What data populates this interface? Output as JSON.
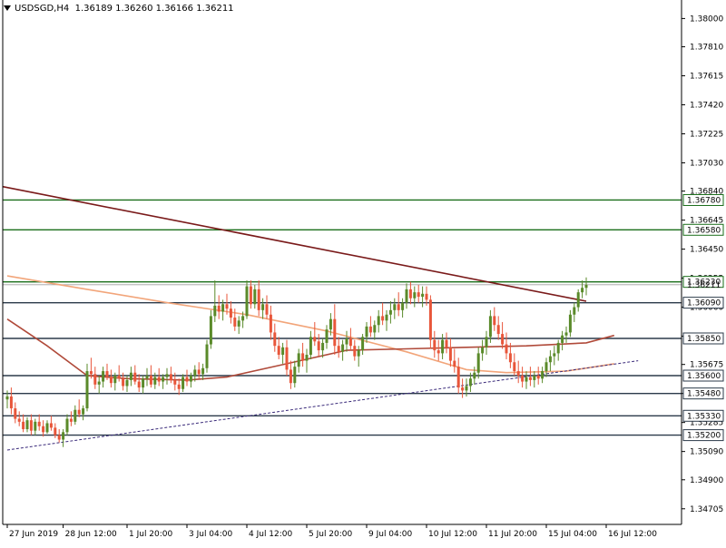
{
  "header": {
    "symbol": "USDSGD,H4",
    "ohlc": "1.36189 1.36260 1.36166 1.36211"
  },
  "colors": {
    "bull": "#5a8a2a",
    "bear": "#e8563a",
    "level": "#1a6e1a",
    "support": "#2b3a4a",
    "ma_slow": "#7a1a1a",
    "ma_mid": "#b04a3a",
    "ma_fast": "#f2a57a",
    "trend": "#3a2a7a"
  },
  "chart_data": {
    "type": "candlestick",
    "symbol": "USDSGD",
    "timeframe": "H4",
    "ylim": [
      1.346,
      1.381
    ],
    "y_ticks": [
      "1.38000",
      "1.37810",
      "1.37615",
      "1.37420",
      "1.37225",
      "1.37030",
      "1.36840",
      "1.36645",
      "1.36450",
      "1.36255",
      "1.36060",
      "1.35865",
      "1.35675",
      "1.35480",
      "1.35285",
      "1.35090",
      "1.34900",
      "1.34705"
    ],
    "x_labels": [
      {
        "i": 0,
        "label": "27 Jun 2019"
      },
      {
        "i": 14,
        "label": "28 Jun 12:00"
      },
      {
        "i": 30,
        "label": "1 Jul 20:00"
      },
      {
        "i": 45,
        "label": "3 Jul 04:00"
      },
      {
        "i": 60,
        "label": "4 Jul 12:00"
      },
      {
        "i": 75,
        "label": "5 Jul 20:00"
      },
      {
        "i": 90,
        "label": "9 Jul 04:00"
      },
      {
        "i": 105,
        "label": "10 Jul 12:00"
      },
      {
        "i": 120,
        "label": "11 Jul 20:00"
      },
      {
        "i": 135,
        "label": "15 Jul 04:00"
      },
      {
        "i": 150,
        "label": "16 Jul 12:00"
      }
    ],
    "candles": [
      [
        1.3544,
        1.355,
        1.3538,
        1.3546
      ],
      [
        1.3546,
        1.3552,
        1.3534,
        1.3538
      ],
      [
        1.3538,
        1.3542,
        1.3528,
        1.3531
      ],
      [
        1.3531,
        1.3536,
        1.3526,
        1.3529
      ],
      [
        1.3529,
        1.3534,
        1.3522,
        1.3524
      ],
      [
        1.3524,
        1.3532,
        1.3522,
        1.353
      ],
      [
        1.353,
        1.3534,
        1.352,
        1.3523
      ],
      [
        1.3523,
        1.3531,
        1.352,
        1.3529
      ],
      [
        1.3529,
        1.3534,
        1.3523,
        1.3526
      ],
      [
        1.3526,
        1.353,
        1.3519,
        1.3522
      ],
      [
        1.3522,
        1.353,
        1.3521,
        1.3528
      ],
      [
        1.3528,
        1.3533,
        1.3523,
        1.3525
      ],
      [
        1.3525,
        1.3528,
        1.3518,
        1.352
      ],
      [
        1.352,
        1.3524,
        1.3515,
        1.3517
      ],
      [
        1.3517,
        1.3524,
        1.3512,
        1.3522
      ],
      [
        1.3522,
        1.3534,
        1.352,
        1.3531
      ],
      [
        1.3531,
        1.3536,
        1.3526,
        1.3529
      ],
      [
        1.3529,
        1.354,
        1.3527,
        1.3537
      ],
      [
        1.3537,
        1.3544,
        1.3532,
        1.3534
      ],
      [
        1.3534,
        1.354,
        1.353,
        1.3538
      ],
      [
        1.3538,
        1.3568,
        1.3536,
        1.3563
      ],
      [
        1.3563,
        1.3572,
        1.3558,
        1.3561
      ],
      [
        1.3561,
        1.3566,
        1.3551,
        1.3554
      ],
      [
        1.3554,
        1.356,
        1.3548,
        1.3556
      ],
      [
        1.3556,
        1.3566,
        1.3552,
        1.3563
      ],
      [
        1.3563,
        1.3568,
        1.3557,
        1.3559
      ],
      [
        1.3559,
        1.3564,
        1.3552,
        1.3555
      ],
      [
        1.3555,
        1.3562,
        1.355,
        1.356
      ],
      [
        1.356,
        1.3567,
        1.3556,
        1.3558
      ],
      [
        1.3558,
        1.3562,
        1.355,
        1.3553
      ],
      [
        1.3553,
        1.356,
        1.3549,
        1.3557
      ],
      [
        1.3557,
        1.3566,
        1.3553,
        1.3562
      ],
      [
        1.3562,
        1.3567,
        1.3554,
        1.3556
      ],
      [
        1.3556,
        1.3561,
        1.3549,
        1.3552
      ],
      [
        1.3552,
        1.356,
        1.3548,
        1.3558
      ],
      [
        1.3558,
        1.3565,
        1.3553,
        1.356
      ],
      [
        1.356,
        1.3567,
        1.3552,
        1.3554
      ],
      [
        1.3554,
        1.3562,
        1.3551,
        1.3559
      ],
      [
        1.3559,
        1.3565,
        1.3553,
        1.3556
      ],
      [
        1.3556,
        1.3561,
        1.3551,
        1.3559
      ],
      [
        1.3559,
        1.3565,
        1.3554,
        1.3561
      ],
      [
        1.3561,
        1.3566,
        1.3555,
        1.3557
      ],
      [
        1.3557,
        1.3562,
        1.355,
        1.3554
      ],
      [
        1.3554,
        1.3558,
        1.3547,
        1.3551
      ],
      [
        1.3551,
        1.3561,
        1.3549,
        1.3559
      ],
      [
        1.3559,
        1.3564,
        1.3553,
        1.3556
      ],
      [
        1.3556,
        1.3562,
        1.3552,
        1.356
      ],
      [
        1.356,
        1.3567,
        1.3556,
        1.3564
      ],
      [
        1.3564,
        1.3569,
        1.3558,
        1.3561
      ],
      [
        1.3561,
        1.3568,
        1.3557,
        1.3565
      ],
      [
        1.3565,
        1.3584,
        1.3562,
        1.3581
      ],
      [
        1.3581,
        1.3604,
        1.3578,
        1.36
      ],
      [
        1.36,
        1.3624,
        1.3596,
        1.3607
      ],
      [
        1.3607,
        1.3614,
        1.3598,
        1.3603
      ],
      [
        1.3603,
        1.3611,
        1.3597,
        1.3608
      ],
      [
        1.3608,
        1.3615,
        1.3601,
        1.3605
      ],
      [
        1.3605,
        1.361,
        1.3595,
        1.3599
      ],
      [
        1.3599,
        1.3605,
        1.359,
        1.3593
      ],
      [
        1.3593,
        1.36,
        1.3588,
        1.3597
      ],
      [
        1.3597,
        1.3603,
        1.3592,
        1.36
      ],
      [
        1.36,
        1.3624,
        1.3598,
        1.362
      ],
      [
        1.362,
        1.3624,
        1.3605,
        1.3608
      ],
      [
        1.3608,
        1.3621,
        1.3605,
        1.3618
      ],
      [
        1.3618,
        1.3624,
        1.36,
        1.3604
      ],
      [
        1.3604,
        1.3612,
        1.3598,
        1.3608
      ],
      [
        1.3608,
        1.3614,
        1.3598,
        1.3601
      ],
      [
        1.3601,
        1.3607,
        1.3584,
        1.3589
      ],
      [
        1.3589,
        1.3595,
        1.3576,
        1.358
      ],
      [
        1.358,
        1.3586,
        1.3571,
        1.3574
      ],
      [
        1.3574,
        1.3582,
        1.3568,
        1.3579
      ],
      [
        1.3579,
        1.3584,
        1.356,
        1.3564
      ],
      [
        1.3564,
        1.357,
        1.3551,
        1.3555
      ],
      [
        1.3555,
        1.357,
        1.3552,
        1.3566
      ],
      [
        1.3566,
        1.3578,
        1.3562,
        1.3575
      ],
      [
        1.3575,
        1.3582,
        1.3566,
        1.357
      ],
      [
        1.357,
        1.3578,
        1.3562,
        1.3574
      ],
      [
        1.3574,
        1.359,
        1.3571,
        1.3586
      ],
      [
        1.3586,
        1.3596,
        1.358,
        1.3583
      ],
      [
        1.3583,
        1.3588,
        1.3573,
        1.3577
      ],
      [
        1.3577,
        1.3585,
        1.3572,
        1.3582
      ],
      [
        1.3582,
        1.3594,
        1.3578,
        1.3591
      ],
      [
        1.3591,
        1.3602,
        1.3587,
        1.3598
      ],
      [
        1.3598,
        1.3608,
        1.3574,
        1.358
      ],
      [
        1.358,
        1.3586,
        1.3572,
        1.3576
      ],
      [
        1.3576,
        1.3584,
        1.357,
        1.3581
      ],
      [
        1.3581,
        1.359,
        1.3576,
        1.3585
      ],
      [
        1.3585,
        1.3592,
        1.3577,
        1.358
      ],
      [
        1.358,
        1.3584,
        1.357,
        1.3573
      ],
      [
        1.3573,
        1.358,
        1.3566,
        1.3577
      ],
      [
        1.3577,
        1.3588,
        1.3574,
        1.3586
      ],
      [
        1.3586,
        1.3596,
        1.3582,
        1.3593
      ],
      [
        1.3593,
        1.36,
        1.3586,
        1.3589
      ],
      [
        1.3589,
        1.3597,
        1.3584,
        1.3594
      ],
      [
        1.3594,
        1.3604,
        1.3589,
        1.36
      ],
      [
        1.36,
        1.3609,
        1.3594,
        1.3597
      ],
      [
        1.3597,
        1.3604,
        1.359,
        1.3601
      ],
      [
        1.3601,
        1.361,
        1.3595,
        1.3604
      ],
      [
        1.3604,
        1.3612,
        1.3598,
        1.3608
      ],
      [
        1.3608,
        1.3616,
        1.36,
        1.3604
      ],
      [
        1.3604,
        1.3612,
        1.3599,
        1.3609
      ],
      [
        1.3609,
        1.3622,
        1.3605,
        1.3618
      ],
      [
        1.3618,
        1.3623,
        1.3608,
        1.3612
      ],
      [
        1.3612,
        1.362,
        1.3606,
        1.3616
      ],
      [
        1.3616,
        1.3621,
        1.3609,
        1.3613
      ],
      [
        1.3613,
        1.362,
        1.3606,
        1.3615
      ],
      [
        1.3615,
        1.362,
        1.3607,
        1.3611
      ],
      [
        1.3611,
        1.3614,
        1.3578,
        1.3584
      ],
      [
        1.3584,
        1.359,
        1.3572,
        1.3577
      ],
      [
        1.3577,
        1.3584,
        1.357,
        1.3575
      ],
      [
        1.3575,
        1.3588,
        1.3571,
        1.3584
      ],
      [
        1.3584,
        1.3589,
        1.3575,
        1.3579
      ],
      [
        1.3579,
        1.3585,
        1.3566,
        1.357
      ],
      [
        1.357,
        1.3578,
        1.3562,
        1.3566
      ],
      [
        1.3566,
        1.3572,
        1.3548,
        1.3552
      ],
      [
        1.3552,
        1.3558,
        1.3545,
        1.355
      ],
      [
        1.355,
        1.3558,
        1.3546,
        1.3553
      ],
      [
        1.3553,
        1.3562,
        1.3549,
        1.3558
      ],
      [
        1.3558,
        1.3566,
        1.3554,
        1.3562
      ],
      [
        1.3562,
        1.3579,
        1.3558,
        1.3575
      ],
      [
        1.3575,
        1.3584,
        1.357,
        1.3579
      ],
      [
        1.3579,
        1.359,
        1.3574,
        1.3586
      ],
      [
        1.3586,
        1.3604,
        1.3582,
        1.36
      ],
      [
        1.36,
        1.3606,
        1.359,
        1.3594
      ],
      [
        1.3594,
        1.36,
        1.3584,
        1.3588
      ],
      [
        1.3588,
        1.3596,
        1.3578,
        1.3581
      ],
      [
        1.3581,
        1.3589,
        1.3571,
        1.3575
      ],
      [
        1.3575,
        1.3582,
        1.3565,
        1.3569
      ],
      [
        1.3569,
        1.3575,
        1.356,
        1.3563
      ],
      [
        1.3563,
        1.357,
        1.3555,
        1.356
      ],
      [
        1.356,
        1.3566,
        1.3552,
        1.3556
      ],
      [
        1.3556,
        1.3563,
        1.3551,
        1.3559
      ],
      [
        1.3559,
        1.3566,
        1.3553,
        1.3557
      ],
      [
        1.3557,
        1.3563,
        1.3552,
        1.356
      ],
      [
        1.356,
        1.3566,
        1.3554,
        1.3558
      ],
      [
        1.3558,
        1.3566,
        1.3555,
        1.3563
      ],
      [
        1.3563,
        1.3572,
        1.3559,
        1.3569
      ],
      [
        1.3569,
        1.3577,
        1.3563,
        1.3573
      ],
      [
        1.3573,
        1.358,
        1.3567,
        1.3575
      ],
      [
        1.3575,
        1.3584,
        1.357,
        1.3582
      ],
      [
        1.3582,
        1.359,
        1.3577,
        1.3587
      ],
      [
        1.3587,
        1.3593,
        1.3582,
        1.3589
      ],
      [
        1.3589,
        1.3604,
        1.3586,
        1.3601
      ],
      [
        1.3601,
        1.3609,
        1.3596,
        1.3606
      ],
      [
        1.3606,
        1.3618,
        1.3603,
        1.3616
      ],
      [
        1.3616,
        1.3624,
        1.3612,
        1.3619
      ],
      [
        1.3619,
        1.3626,
        1.3614,
        1.3621
      ]
    ],
    "horizontal_levels": [
      {
        "value": 1.3678,
        "label": "1.36780",
        "kind": "level"
      },
      {
        "value": 1.3658,
        "label": "1.36580",
        "kind": "level"
      },
      {
        "value": 1.3623,
        "label": "1.36230",
        "kind": "level"
      },
      {
        "value": 1.3609,
        "label": "1.36090",
        "kind": "support"
      },
      {
        "value": 1.3585,
        "label": "1.35850",
        "kind": "support"
      },
      {
        "value": 1.356,
        "label": "1.35600",
        "kind": "support"
      },
      {
        "value": 1.3548,
        "label": "1.35480",
        "kind": "support"
      },
      {
        "value": 1.3533,
        "label": "1.35330",
        "kind": "support"
      },
      {
        "value": 1.352,
        "label": "1.35200",
        "kind": "support"
      }
    ],
    "current_price": {
      "value": 1.36211,
      "label": "1.36211"
    },
    "moving_averages": [
      {
        "color_key": "ma_slow",
        "from": 1.3687,
        "to": 1.361
      },
      {
        "color_key": "ma_fast",
        "points": [
          [
            0,
            1.3627
          ],
          [
            20,
            1.3618
          ],
          [
            40,
            1.3609
          ],
          [
            60,
            1.3601
          ],
          [
            80,
            1.359
          ],
          [
            100,
            1.3576
          ],
          [
            115,
            1.3564
          ],
          [
            125,
            1.3562
          ],
          [
            140,
            1.3563
          ],
          [
            152,
            1.3568
          ]
        ]
      },
      {
        "color_key": "ma_mid",
        "points": [
          [
            0,
            1.3598
          ],
          [
            10,
            1.358
          ],
          [
            20,
            1.356
          ],
          [
            30,
            1.3558
          ],
          [
            45,
            1.3557
          ],
          [
            55,
            1.3559
          ],
          [
            70,
            1.3568
          ],
          [
            85,
            1.3577
          ],
          [
            100,
            1.3578
          ],
          [
            115,
            1.3579
          ],
          [
            130,
            1.358
          ],
          [
            145,
            1.3582
          ],
          [
            152,
            1.3587
          ]
        ]
      }
    ],
    "trendline": {
      "from": [
        0,
        1.351
      ],
      "to": [
        158,
        1.357
      ]
    }
  }
}
